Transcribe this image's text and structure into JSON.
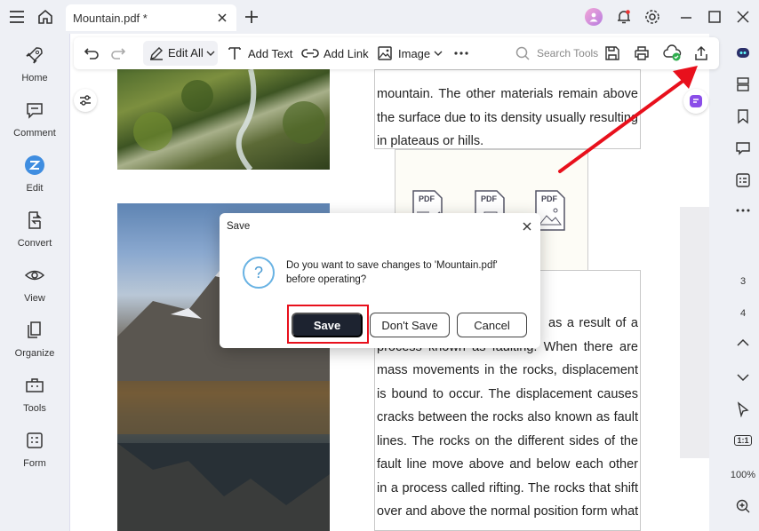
{
  "tab": {
    "title": "Mountain.pdf *"
  },
  "sidebar": {
    "items": [
      {
        "label": "Home"
      },
      {
        "label": "Comment"
      },
      {
        "label": "Edit"
      },
      {
        "label": "Convert"
      },
      {
        "label": "View"
      },
      {
        "label": "Organize"
      },
      {
        "label": "Tools"
      },
      {
        "label": "Form"
      }
    ]
  },
  "toolbar": {
    "edit_all": "Edit All",
    "add_text": "Add Text",
    "add_link": "Add Link",
    "image": "Image",
    "search_placeholder": "Search Tools"
  },
  "document": {
    "text_top": [
      "mountain. The other materials remain above",
      "the surface due to its density usually resulting",
      "in plateaus or hills."
    ],
    "text_bottom": [
      "as a result of a",
      "process known as faulting. When there are",
      "mass movements in the rocks, displacement",
      "is bound to occur. The displacement causes",
      "cracks between the rocks also known as fault",
      "lines. The rocks on the different sides of the",
      "fault line move above and below each other",
      "in a process called rifting. The rocks that shift",
      "over and above the normal position form what"
    ],
    "fig_labels": [
      "PDF",
      "PDF",
      "PDF"
    ]
  },
  "rightbar": {
    "page_current": "3",
    "page_next": "4",
    "fit_label": "1:1",
    "zoom": "100%"
  },
  "dialog": {
    "title": "Save",
    "message": "Do you want to save changes to 'Mountain.pdf' before operating?",
    "save": "Save",
    "dont_save": "Don't Save",
    "cancel": "Cancel"
  },
  "colors": {
    "accent": "#1d2330",
    "highlight": "#e8101c",
    "info_icon": "#68b2e3"
  }
}
